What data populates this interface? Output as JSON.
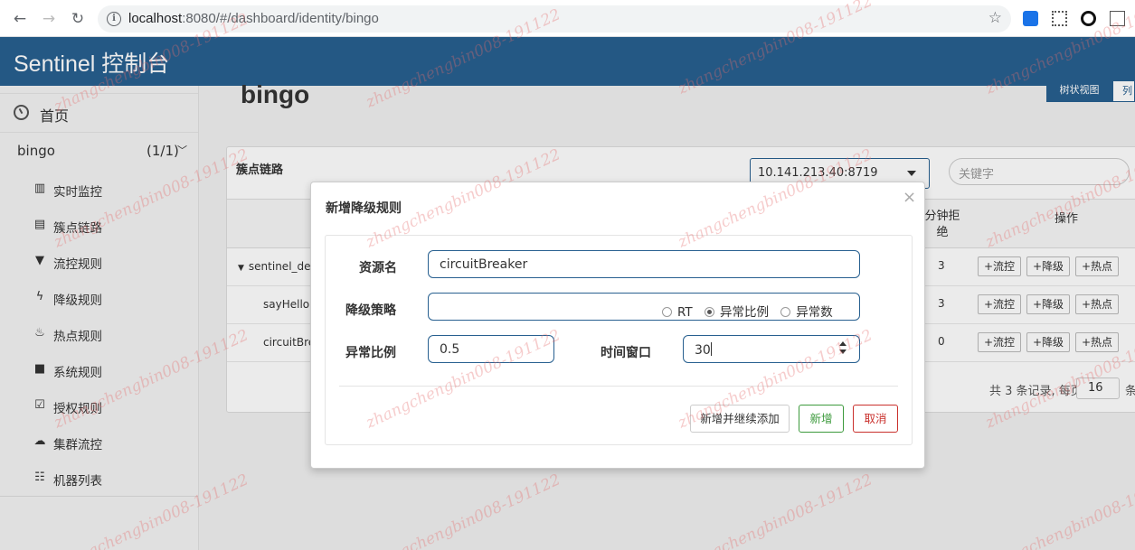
{
  "browser": {
    "url_host": "localhost",
    "url_rest": ":8080/#/dashboard/identity/bingo"
  },
  "header": {
    "brand": "Sentinel 控制台"
  },
  "sidebar": {
    "home_label": "首页",
    "app_name": "bingo",
    "app_count": "(1/1)",
    "items": [
      {
        "label": "实时监控",
        "icon": "bar-chart-icon"
      },
      {
        "label": "簇点链路",
        "icon": "list-icon"
      },
      {
        "label": "流控规则",
        "icon": "filter-icon"
      },
      {
        "label": "降级规则",
        "icon": "flash-icon"
      },
      {
        "label": "热点规则",
        "icon": "fire-icon"
      },
      {
        "label": "系统规则",
        "icon": "lock-icon"
      },
      {
        "label": "授权规则",
        "icon": "check-icon"
      },
      {
        "label": "集群流控",
        "icon": "cloud-icon"
      },
      {
        "label": "机器列表",
        "icon": "th-list-icon"
      }
    ]
  },
  "main": {
    "title": "bingo",
    "view_tree": "树状视图",
    "view_list": "列表视图",
    "panel_title": "簇点链路",
    "machine": "10.141.213.40:8719",
    "keyword_placeholder": "关键字",
    "col_reject": "分钟拒绝",
    "col_ops": "操作",
    "rows": [
      {
        "name": "sentinel_default_context",
        "reject": "3"
      },
      {
        "name": "sayHello",
        "reject": "3"
      },
      {
        "name": "circuitBreaker",
        "reject": "0"
      }
    ],
    "row_buttons": [
      "+流控",
      "+降级",
      "+热点"
    ],
    "pager_text": "共 3 条记录, 每页",
    "page_size": "16",
    "pager_tail": "条"
  },
  "modal": {
    "title": "新增降级规则",
    "close": "×",
    "resource_label": "资源名",
    "resource_value": "circuitBreaker",
    "strategy_label": "降级策略",
    "strategy_options": [
      "RT",
      "异常比例",
      "异常数"
    ],
    "strategy_selected": "异常比例",
    "ratio_label": "异常比例",
    "ratio_value": "0.5",
    "window_label": "时间窗口",
    "window_value": "30",
    "btn_continue": "新增并继续添加",
    "btn_add": "新增",
    "btn_cancel": "取消"
  },
  "watermark": "zhangchengbin008-191122"
}
